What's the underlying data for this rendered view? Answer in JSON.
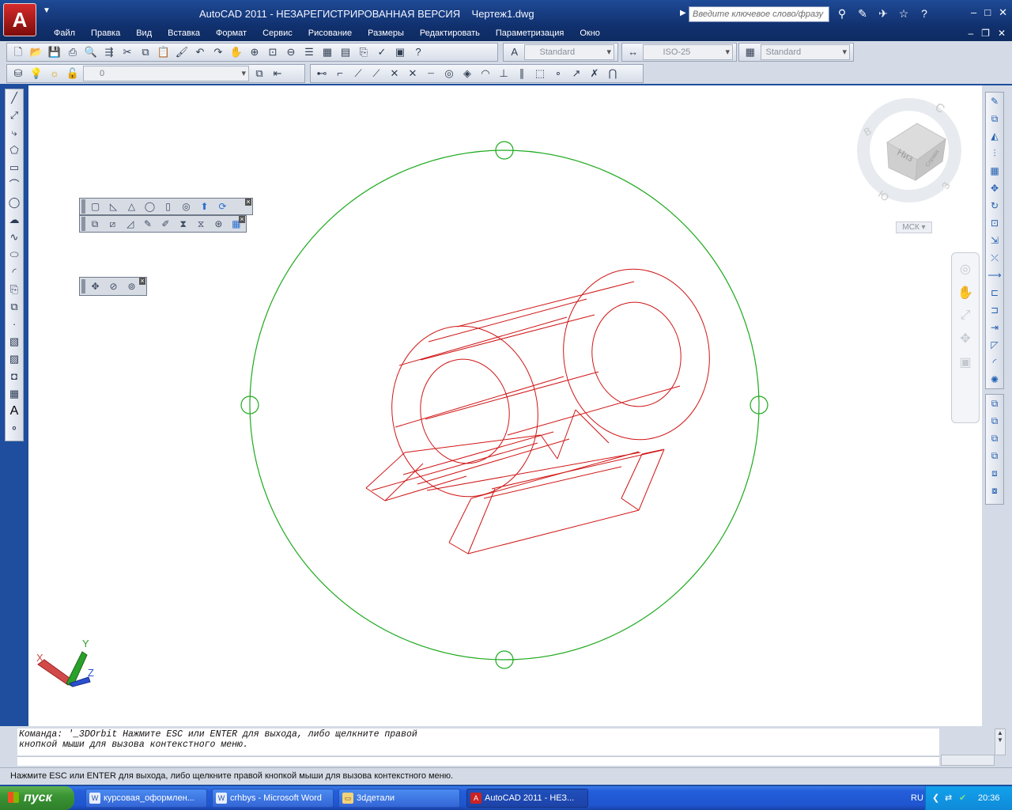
{
  "window": {
    "logo_letter": "A",
    "title": "AutoCAD 2011 - НЕЗАРЕГИСТРИРОВАННАЯ ВЕРСИЯ    Чертеж1.dwg",
    "search_placeholder": "Введите ключевое слово/фразу"
  },
  "menu": [
    "Файл",
    "Правка",
    "Вид",
    "Вставка",
    "Формат",
    "Сервис",
    "Рисование",
    "Размеры",
    "Редактировать",
    "Параметризация",
    "Окно"
  ],
  "toolbar": {
    "text_style": "Standard",
    "dim_style": "ISO-25",
    "table_style": "Standard",
    "layer": "0"
  },
  "viewcube": {
    "face_label": "Низ",
    "side_label": "Справа",
    "compass": {
      "top": "С",
      "left": "В",
      "right": "З",
      "bottom": "Ю"
    },
    "ucs_label": "МСК"
  },
  "ucs_axes": {
    "x": "X",
    "y": "Y",
    "z": "Z"
  },
  "command": {
    "line1": "Команда: '_3DOrbit Нажмите ESC или ENTER для выхода, либо щелкните правой",
    "line2": "кнопкой мыши для вызова контекстного меню."
  },
  "status": "Нажмите ESC или ENTER для выхода, либо щелкните правой кнопкой мыши для вызова контекстного меню.",
  "taskbar": {
    "start": "пуск",
    "items": [
      "курсовая_оформлен...",
      "crhbys - Microsoft Word",
      "3dдетали",
      "AutoCAD 2011 - НЕЗ..."
    ],
    "lang": "RU",
    "time": "20:36"
  },
  "colors": {
    "orbit": "#1faa1f",
    "model": "#d01515",
    "canvas": "#ffffff",
    "ui_blue": "#10306d"
  }
}
